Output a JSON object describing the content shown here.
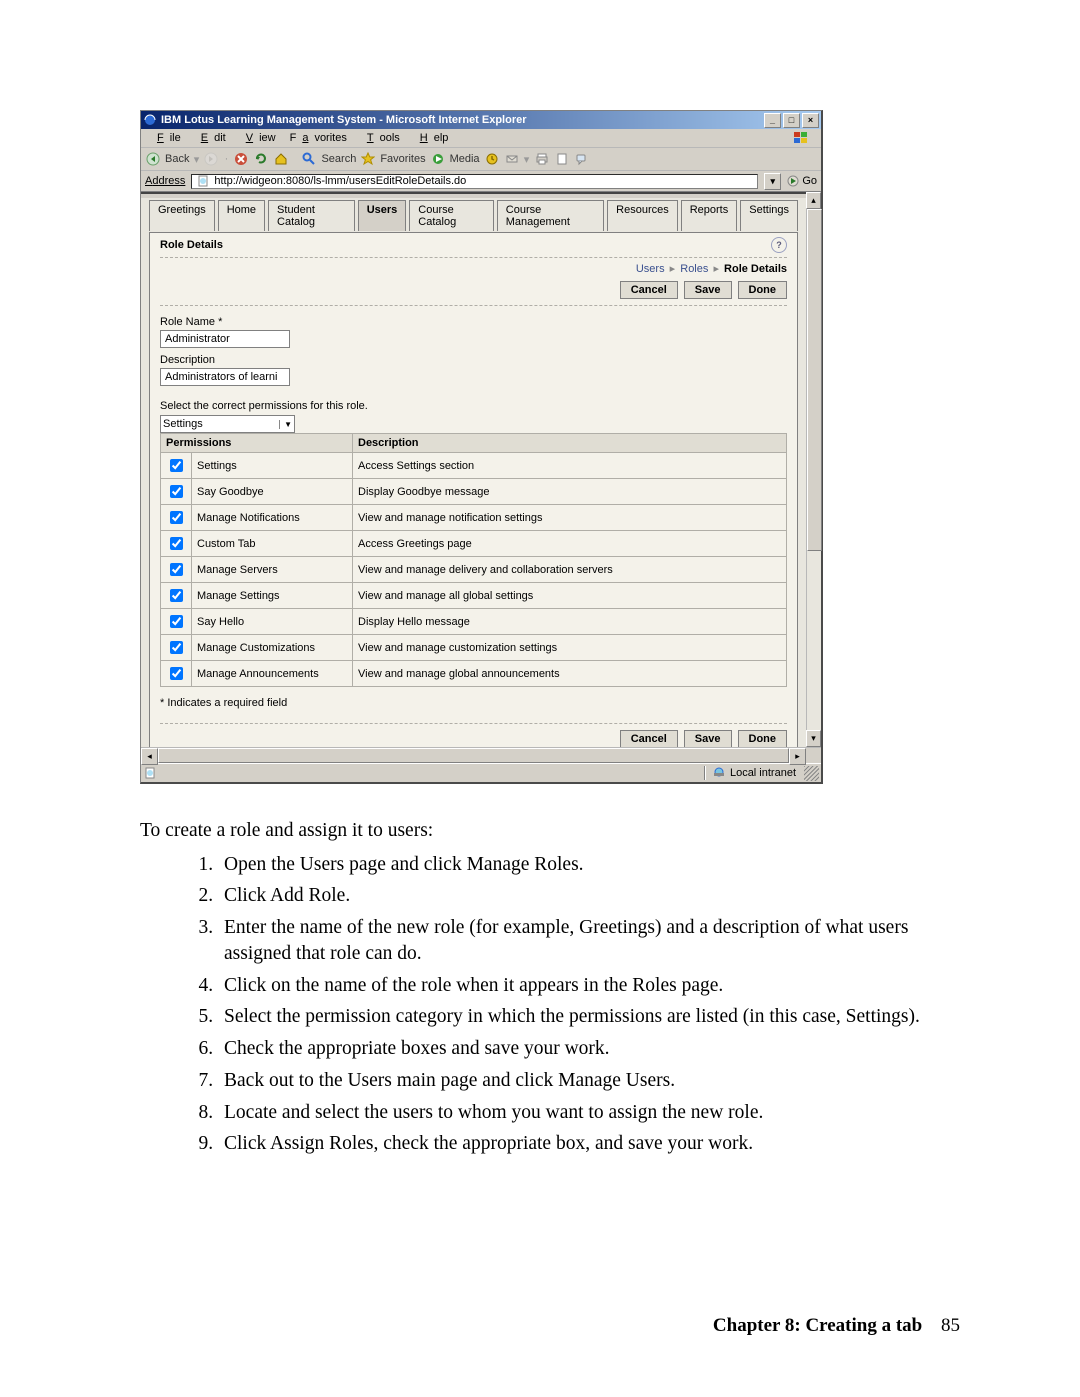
{
  "window": {
    "title": "IBM Lotus Learning Management System - Microsoft Internet Explorer",
    "menu": {
      "file": "File",
      "edit": "Edit",
      "view": "View",
      "favorites": "Favorites",
      "tools": "Tools",
      "help": "Help"
    },
    "toolbar": {
      "back": "Back",
      "search": "Search",
      "favorites": "Favorites",
      "media": "Media"
    },
    "address_label": "Address",
    "address_url": "http://widgeon:8080/ls-lmm/usersEditRoleDetails.do",
    "go_label": "Go",
    "status_zone": "Local intranet"
  },
  "app": {
    "tabs": [
      "Greetings",
      "Home",
      "Student Catalog",
      "Users",
      "Course Catalog",
      "Course Management",
      "Resources",
      "Reports",
      "Settings"
    ],
    "active_tab_index": 3,
    "panel_title": "Role Details",
    "breadcrumb": {
      "a": "Users",
      "b": "Roles",
      "current": "Role Details"
    },
    "buttons": {
      "cancel": "Cancel",
      "save": "Save",
      "done": "Done"
    },
    "role_name_label": "Role Name *",
    "role_name_value": "Administrator",
    "description_label": "Description",
    "description_value": "Administrators of learni",
    "perm_instruction": "Select the correct permissions for this role.",
    "perm_category_selected": "Settings",
    "table_headers": {
      "perm": "Permissions",
      "desc": "Description"
    },
    "permissions": [
      {
        "name": "Settings",
        "desc": "Access Settings section",
        "checked": true
      },
      {
        "name": "Say Goodbye",
        "desc": "Display Goodbye message",
        "checked": true
      },
      {
        "name": "Manage Notifications",
        "desc": "View and manage notification settings",
        "checked": true
      },
      {
        "name": "Custom Tab",
        "desc": "Access Greetings page",
        "checked": true
      },
      {
        "name": "Manage Servers",
        "desc": "View and manage delivery and collaboration servers",
        "checked": true
      },
      {
        "name": "Manage Settings",
        "desc": "View and manage all global settings",
        "checked": true
      },
      {
        "name": "Say Hello",
        "desc": "Display Hello message",
        "checked": true
      },
      {
        "name": "Manage Customizations",
        "desc": "View and manage customization settings",
        "checked": true
      },
      {
        "name": "Manage Announcements",
        "desc": "View and manage global announcements",
        "checked": true
      }
    ],
    "required_note": "* Indicates a required field"
  },
  "body": {
    "intro": "To create a role and assign it to users:",
    "steps": [
      "Open the Users page and click Manage Roles.",
      "Click Add Role.",
      "Enter the name of the new role (for example, Greetings) and a description of what users assigned that role can do.",
      "Click on the name of the role when it appears in the Roles page.",
      "Select the permission category in which the permissions are listed (in this case, Settings).",
      "Check the appropriate boxes and save your work.",
      "Back out to the Users main page and click Manage Users.",
      "Locate and select the users to whom you want to assign the new role.",
      "Click Assign Roles, check the appropriate box, and save your work."
    ]
  },
  "footer": {
    "chapter": "Chapter 8: Creating a tab",
    "page": "85"
  }
}
